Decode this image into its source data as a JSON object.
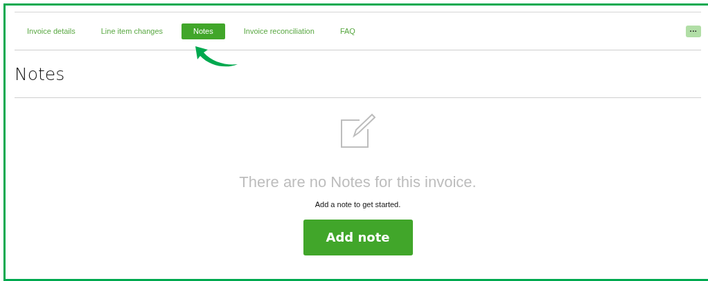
{
  "tabs": [
    {
      "label": "Invoice details",
      "selected": false
    },
    {
      "label": "Line item changes",
      "selected": false
    },
    {
      "label": "Notes",
      "selected": true
    },
    {
      "label": "Invoice reconciliation",
      "selected": false
    },
    {
      "label": "FAQ",
      "selected": false
    }
  ],
  "more_button": {
    "label": "···"
  },
  "heading": "Notes",
  "empty_state": {
    "title": "There are no Notes for this invoice.",
    "subtitle": "Add a note to get started.",
    "button": "Add note"
  }
}
